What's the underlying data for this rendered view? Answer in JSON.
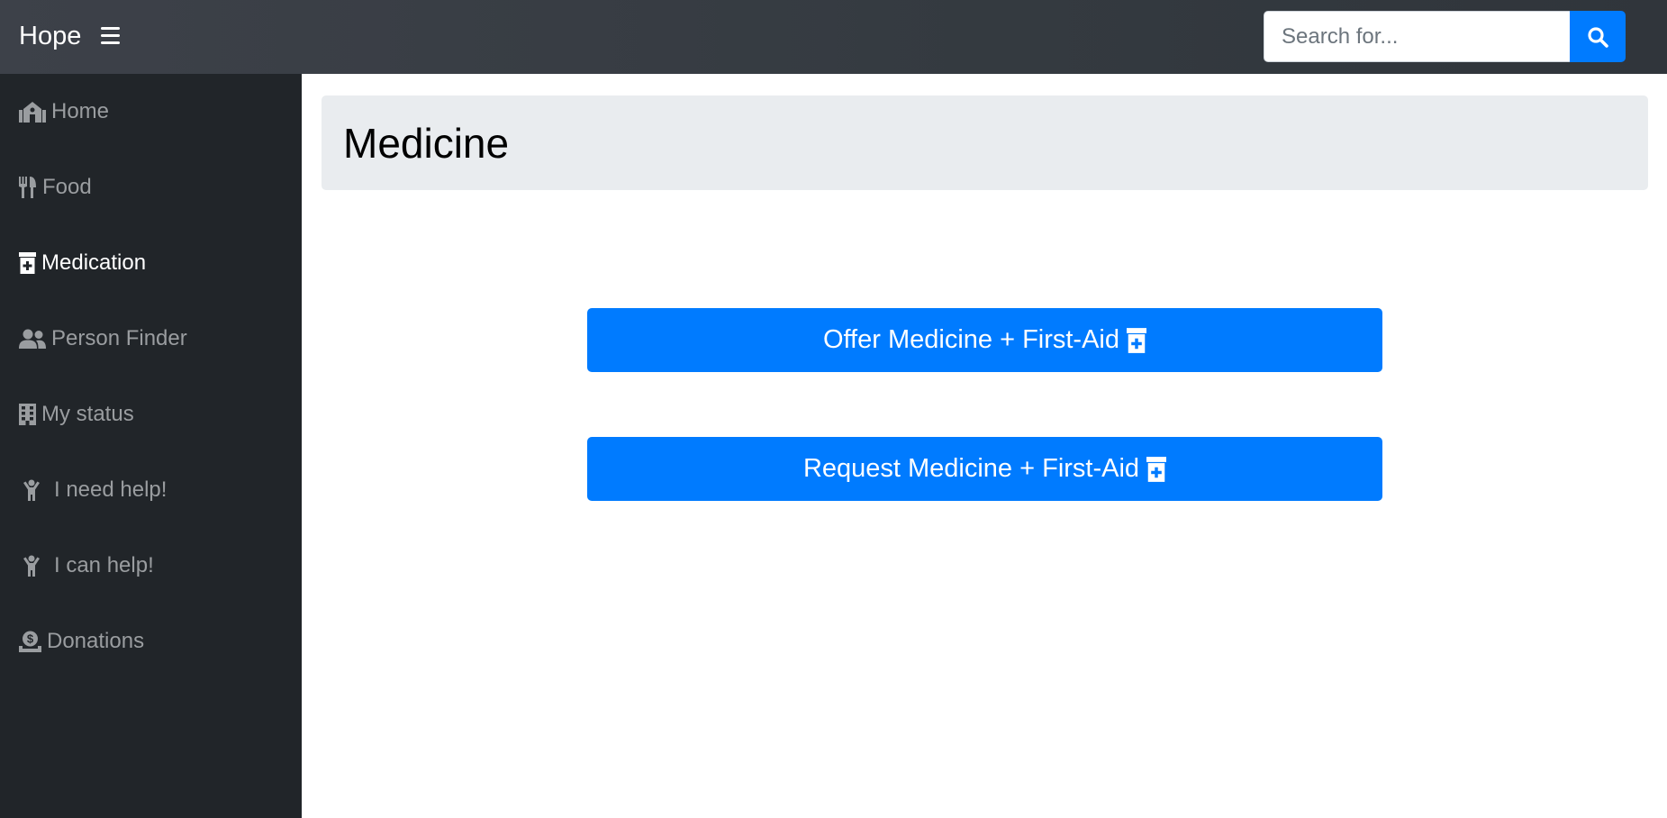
{
  "app": {
    "brand": "Hope"
  },
  "search": {
    "placeholder": "Search for...",
    "value": ""
  },
  "sidebar": {
    "items": [
      {
        "label": "Home",
        "icon": "home-icon"
      },
      {
        "label": "Food",
        "icon": "utensils-icon"
      },
      {
        "label": "Medication",
        "icon": "prescription-bottle-icon",
        "active": true
      },
      {
        "label": "Person Finder",
        "icon": "users-icon"
      },
      {
        "label": "My status",
        "icon": "building-icon"
      },
      {
        "label": "I need help!",
        "icon": "child-icon"
      },
      {
        "label": "I can help!",
        "icon": "child-icon"
      },
      {
        "label": "Donations",
        "icon": "donate-icon"
      }
    ]
  },
  "main": {
    "title": "Medicine",
    "offer_button": "Offer Medicine + First-Aid",
    "request_button": "Request Medicine + First-Aid"
  },
  "colors": {
    "primary": "#007bff",
    "sidebar_bg": "#212529",
    "topbar_bg": "#343a40",
    "jumbotron_bg": "#e9ecef",
    "nav_text": "#9a9da0",
    "nav_active_text": "#ffffff"
  }
}
